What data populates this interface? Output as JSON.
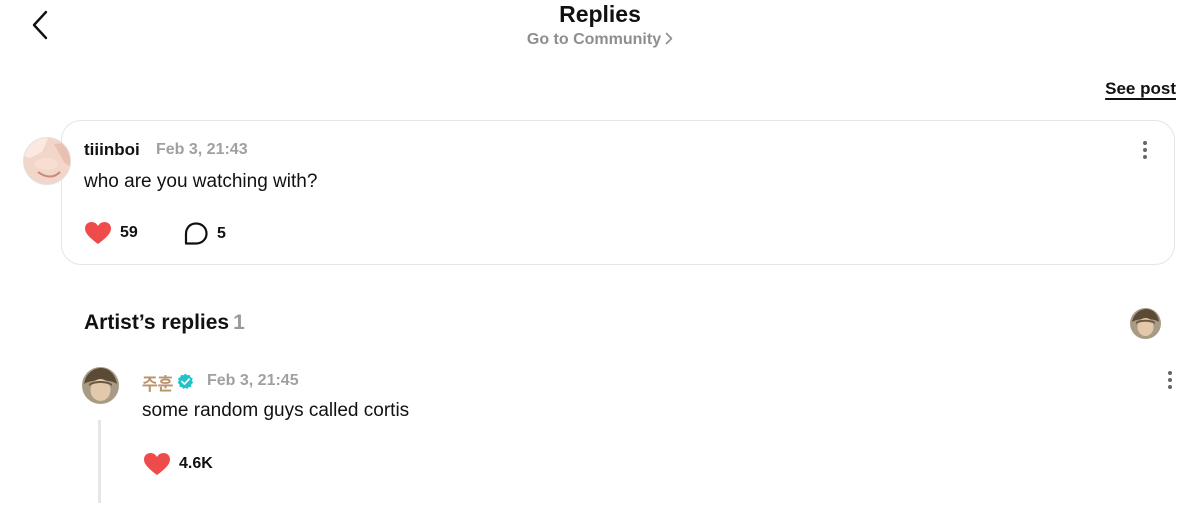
{
  "header": {
    "title": "Replies",
    "subtitle": "Go to Community",
    "see_post": "See post"
  },
  "post": {
    "author": "tiiinboi",
    "time": "Feb 3, 21:43",
    "text": "who are you watching with?",
    "likes": "59",
    "comments": "5"
  },
  "artist_replies": {
    "title": "Artist’s replies",
    "count": "1"
  },
  "reply": {
    "author": "주훈",
    "time": "Feb 3, 21:45",
    "text": "some random guys called cortis",
    "likes": "4.6K"
  },
  "colors": {
    "heart": "#ef4b4b",
    "verified": "#1fc3c8",
    "artist_name": "#b89269",
    "muted": "#a0a0a0"
  },
  "icons": [
    "back-icon",
    "chevron-right-icon",
    "more-vertical-icon",
    "heart-icon",
    "comment-icon",
    "verified-badge-icon"
  ]
}
